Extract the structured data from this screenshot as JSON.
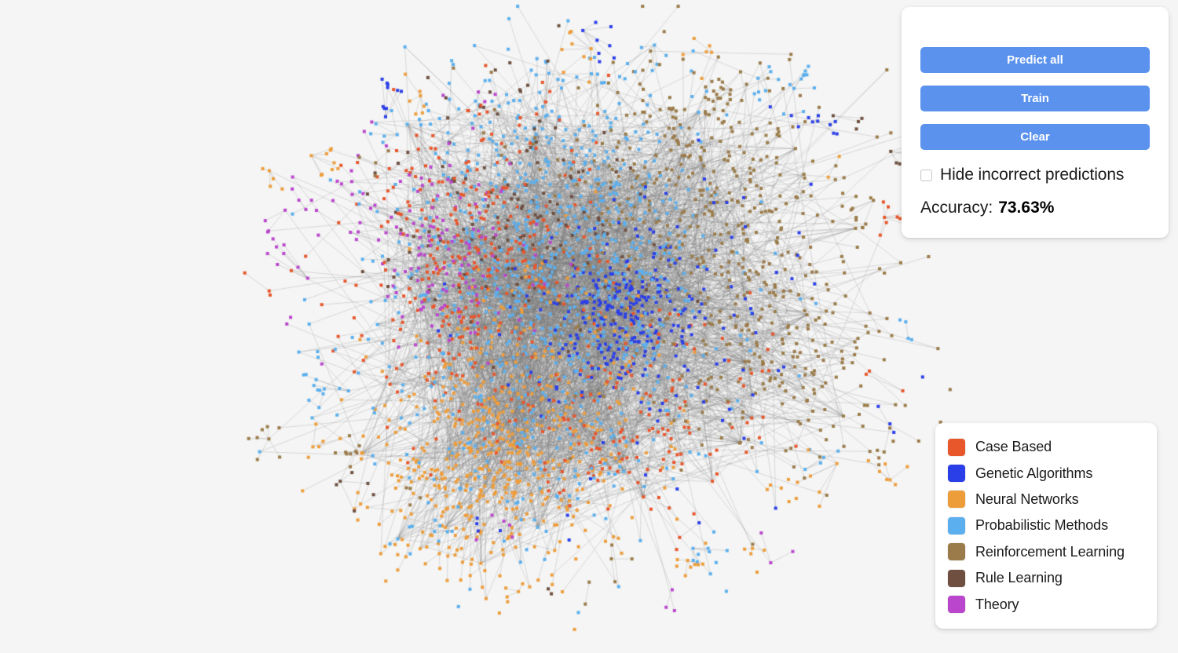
{
  "background_color": "#f4f5f4",
  "graph": {
    "name": "citation-network-graph",
    "node_count": 2708,
    "layout": "force-directed",
    "edge_color": "#9a9a9a",
    "node_size_px": 4
  },
  "control_panel": {
    "buttons": [
      {
        "id": "predict-all",
        "label": "Predict all"
      },
      {
        "id": "train",
        "label": "Train"
      },
      {
        "id": "clear",
        "label": "Clear"
      }
    ],
    "button_color": "#5b92ee",
    "checkbox": {
      "label": "Hide incorrect predictions",
      "checked": false
    },
    "accuracy": {
      "label": "Accuracy:",
      "value": "73.63%"
    }
  },
  "legend": {
    "items": [
      {
        "label": "Case Based",
        "color": "#e8562c"
      },
      {
        "label": "Genetic Algorithms",
        "color": "#2b3fe8"
      },
      {
        "label": "Neural Networks",
        "color": "#ee9d3b"
      },
      {
        "label": "Probabilistic Methods",
        "color": "#5bafee"
      },
      {
        "label": "Reinforcement Learning",
        "color": "#9b7b4a"
      },
      {
        "label": "Rule Learning",
        "color": "#6e4f40"
      },
      {
        "label": "Theory",
        "color": "#bb46ce"
      }
    ]
  }
}
